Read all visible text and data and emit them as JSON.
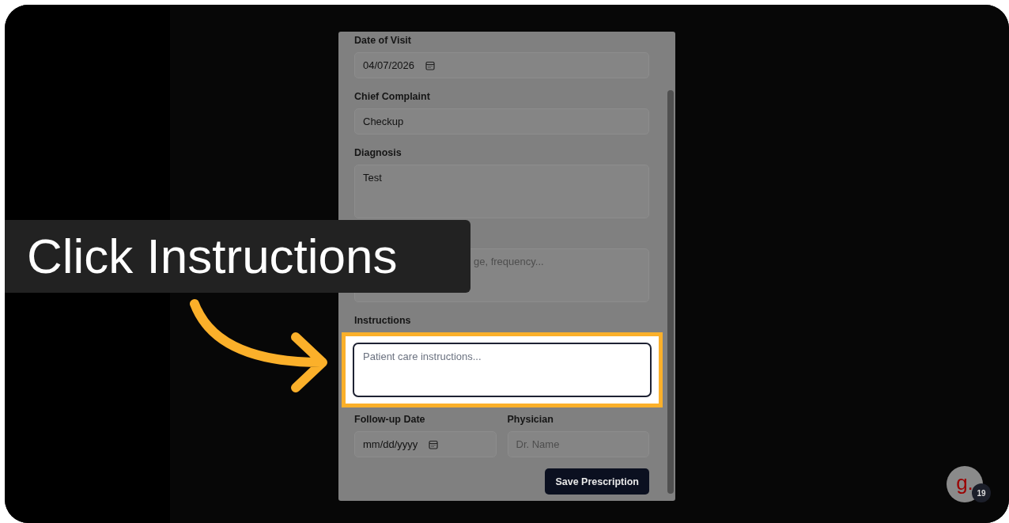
{
  "modal": {
    "fields": [
      {
        "kind": "date",
        "label": "Date of Visit",
        "value": "04/07/2026",
        "focused": false
      },
      {
        "kind": "text",
        "label": "Chief Complaint",
        "value": "Checkup",
        "focused": false
      },
      {
        "kind": "textarea",
        "label": "Diagnosis",
        "value": "Test",
        "focused": false
      },
      {
        "kind": "textarea",
        "placeholder": "ge, frequency...",
        "focused": false
      },
      {
        "kind": "textarea",
        "label": "Instructions",
        "placeholder": "Patient care instructions...",
        "focused": true
      }
    ],
    "row": [
      {
        "kind": "date",
        "label": "Follow-up Date",
        "placeholder": "mm/dd/yyyy",
        "focused": false
      },
      {
        "kind": "text",
        "label": "Physician",
        "placeholder": "Dr. Name",
        "focused": false
      }
    ],
    "submit": "Save Prescription"
  },
  "callout": {
    "text": "Click Instructions"
  },
  "badge": {
    "letter": "g.",
    "count": "19"
  }
}
